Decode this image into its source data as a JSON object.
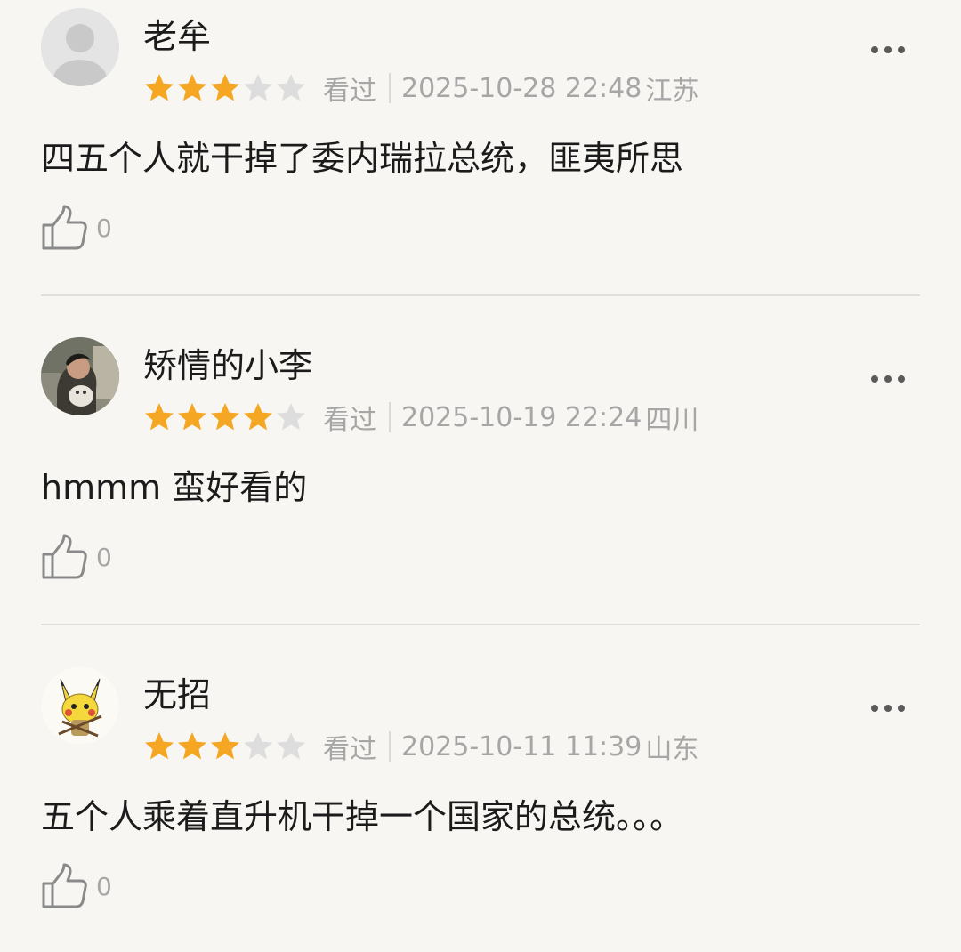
{
  "colors": {
    "background": "#f7f6f2",
    "star_filled": "#f5a623",
    "star_empty": "#dddddd",
    "meta_text": "#a6a6a6",
    "body_text": "#1b1b1b"
  },
  "reviews": [
    {
      "username": "老牟",
      "avatar": "default-avatar",
      "rating": 3,
      "max_rating": 5,
      "status": "看过",
      "datetime": "2025-10-28 22:48",
      "location": "江苏",
      "comment": "四五个人就干掉了委内瑞拉总统，匪夷所思",
      "likes": "0",
      "more_icon": "more-horizontal-icon",
      "like_icon": "thumbs-up-icon"
    },
    {
      "username": "矫情的小李",
      "avatar": "photo-avatar",
      "rating": 4,
      "max_rating": 5,
      "status": "看过",
      "datetime": "2025-10-19 22:24",
      "location": "四川",
      "comment": "hmmm 蛮好看的",
      "likes": "0",
      "more_icon": "more-horizontal-icon",
      "like_icon": "thumbs-up-icon"
    },
    {
      "username": "无招",
      "avatar": "pikachu-avatar",
      "rating": 3,
      "max_rating": 5,
      "status": "看过",
      "datetime": "2025-10-11 11:39",
      "location": "山东",
      "comment": "五个人乘着直升机干掉一个国家的总统。。。",
      "likes": "0",
      "more_icon": "more-horizontal-icon",
      "like_icon": "thumbs-up-icon"
    }
  ]
}
